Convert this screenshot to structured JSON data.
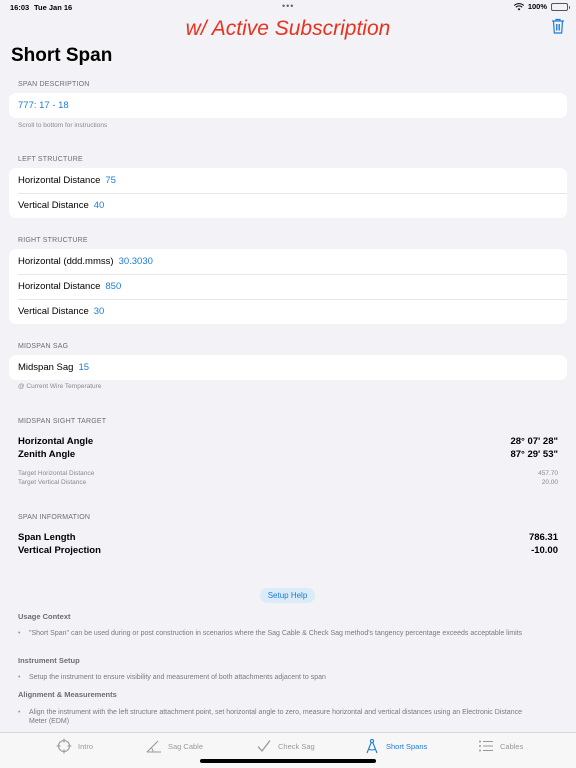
{
  "status": {
    "time": "16:03",
    "date": "Tue Jan 16",
    "battery": "100%",
    "battery_level": 1.0
  },
  "banner": "w/ Active Subscription",
  "page_title": "Short Span",
  "span_description": {
    "header": "SPAN DESCRIPTION",
    "value": "777: 17 - 18",
    "footnote": "Scroll to bottom for instructions"
  },
  "left_structure": {
    "header": "LEFT STRUCTURE",
    "rows": [
      {
        "label": "Horizontal Distance",
        "value": "75"
      },
      {
        "label": "Vertical Distance",
        "value": "40"
      }
    ]
  },
  "right_structure": {
    "header": "RIGHT STRUCTURE",
    "rows": [
      {
        "label": "Horizontal (ddd.mmss)",
        "value": "30.3030"
      },
      {
        "label": "Horizontal Distance",
        "value": "850"
      },
      {
        "label": "Vertical Distance",
        "value": "30"
      }
    ]
  },
  "midspan_sag": {
    "header": "MIDSPAN SAG",
    "label": "Midspan Sag",
    "value": "15",
    "footnote": "@ Current Wire Temperature"
  },
  "midspan_sight_target": {
    "header": "MIDSPAN SIGHT TARGET",
    "horizontal_angle_label": "Horizontal Angle",
    "horizontal_angle_value": "28° 07' 28\"",
    "zenith_angle_label": "Zenith Angle",
    "zenith_angle_value": "87° 29' 53\"",
    "target_h_label": "Target Horizontal Distance",
    "target_h_value": "457.70",
    "target_v_label": "Target Vertical Distance",
    "target_v_value": "20.00"
  },
  "span_information": {
    "header": "SPAN INFORMATION",
    "span_length_label": "Span Length",
    "span_length_value": "786.31",
    "vertical_projection_label": "Vertical Projection",
    "vertical_projection_value": "-10.00"
  },
  "setup_help_label": "Setup Help",
  "help": {
    "usage_title": "Usage Context",
    "usage_text": "\"Short Span\" can be used during or post construction in scenarios where the Sag Cable & Check Sag method's tangency percentage exceeds acceptable limits",
    "instrument_title": "Instrument Setup",
    "instrument_text": "Setup the instrument to ensure visibility and measurement of both attachments adjacent to span",
    "alignment_title": "Alignment & Measurements",
    "alignment_text": "Align the instrument with the left structure attachment point, set horizontal angle to zero, measure horizontal and vertical distances using an Electronic Distance Meter (EDM)"
  },
  "tabs": [
    {
      "label": "Intro",
      "icon": "crosshair-icon"
    },
    {
      "label": "Sag Cable",
      "icon": "angle-icon"
    },
    {
      "label": "Check Sag",
      "icon": "checkmark-icon"
    },
    {
      "label": "Short Spans",
      "icon": "compass-icon",
      "active": true
    },
    {
      "label": "Cables",
      "icon": "list-icon"
    }
  ],
  "colors": {
    "accent": "#1c7cd6",
    "banner": "#e8321e",
    "background": "#f2f2f7"
  }
}
